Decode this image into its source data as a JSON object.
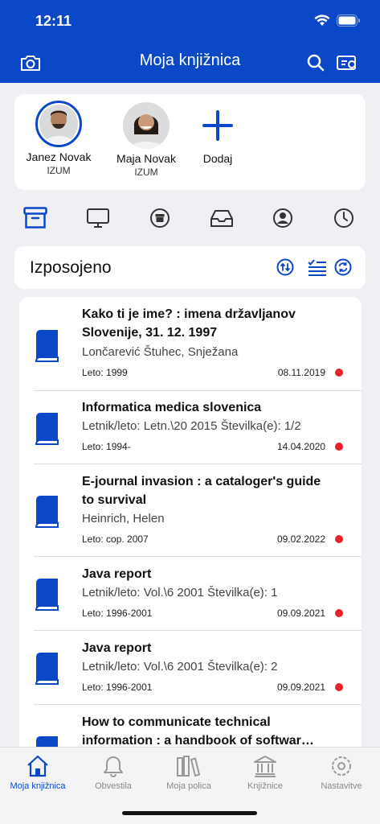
{
  "status": {
    "time": "12:11"
  },
  "header": {
    "title": "Moja knjižnica"
  },
  "profiles": [
    {
      "name": "Janez Novak",
      "org": "IZUM"
    },
    {
      "name": "Maja Novak",
      "org": "IZUM"
    },
    {
      "name": "Dodaj",
      "org": ""
    }
  ],
  "section": {
    "title": "Izposojeno"
  },
  "items": [
    {
      "title_l1": "Kako ti je ime? : imena državljanov",
      "title_l2": "Slovenije, 31. 12. 1997",
      "sub": "Lončarević Štuhec, Snježana",
      "meta": "Leto: 1999",
      "date": "08.11.2019"
    },
    {
      "title_l1": "Informatica medica slovenica",
      "title_l2": "",
      "sub": "Letnik/leto: Letn.\\20 2015 Številka(e): 1/2",
      "meta": "Leto: 1994-",
      "date": "14.04.2020"
    },
    {
      "title_l1": "E-journal invasion : a cataloger's guide",
      "title_l2": "to survival",
      "sub": "Heinrich, Helen",
      "meta": "Leto: cop. 2007",
      "date": "09.02.2022"
    },
    {
      "title_l1": "Java report",
      "title_l2": "",
      "sub": "Letnik/leto: Vol.\\6 2001 Številka(e): 1",
      "meta": "Leto: 1996-2001",
      "date": "09.09.2021"
    },
    {
      "title_l1": "Java report",
      "title_l2": "",
      "sub": "Letnik/leto: Vol.\\6 2001 Številka(e): 2",
      "meta": "Leto: 1996-2001",
      "date": "09.09.2021"
    },
    {
      "title_l1": "How to communicate technical",
      "title_l2": "information : a handbook of softwar…",
      "sub": "",
      "meta": "",
      "date": ""
    }
  ],
  "tabs": [
    {
      "label": "Moja knjižnica",
      "icon": "home-icon"
    },
    {
      "label": "Obvestila",
      "icon": "bell-icon"
    },
    {
      "label": "Moja polica",
      "icon": "shelf-icon"
    },
    {
      "label": "Knjižnice",
      "icon": "library-icon"
    },
    {
      "label": "Nastavitve",
      "icon": "settings-icon"
    }
  ],
  "colors": {
    "primary": "#0a48c8",
    "alert": "#e8212a"
  }
}
